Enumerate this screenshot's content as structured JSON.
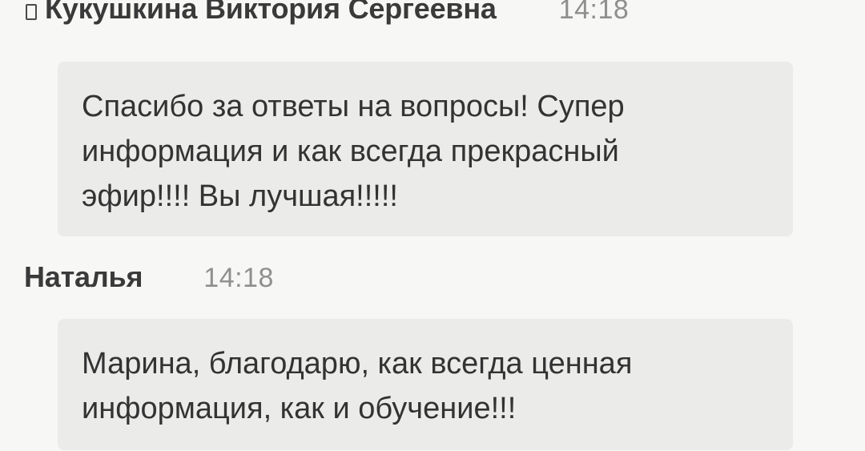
{
  "messages": [
    {
      "sender": "Кукушкина Виктория Сергеевна",
      "time": "14:18",
      "device_icon": "phone-icon",
      "text": "Спасибо за ответы на вопросы! Супер\nинформация и как всегда прекрасный\nэфир!!!! Вы лучшая!!!!!"
    },
    {
      "sender": "Наталья",
      "time": "14:18",
      "text": "Марина, благодарю, как всегда ценная\nинформация, как и обучение!!!"
    }
  ],
  "colors": {
    "background": "#f7f7f5",
    "bubble": "#ebebea",
    "sender": "#3a3a3a",
    "time": "#8f8f8f",
    "text": "#333333"
  }
}
